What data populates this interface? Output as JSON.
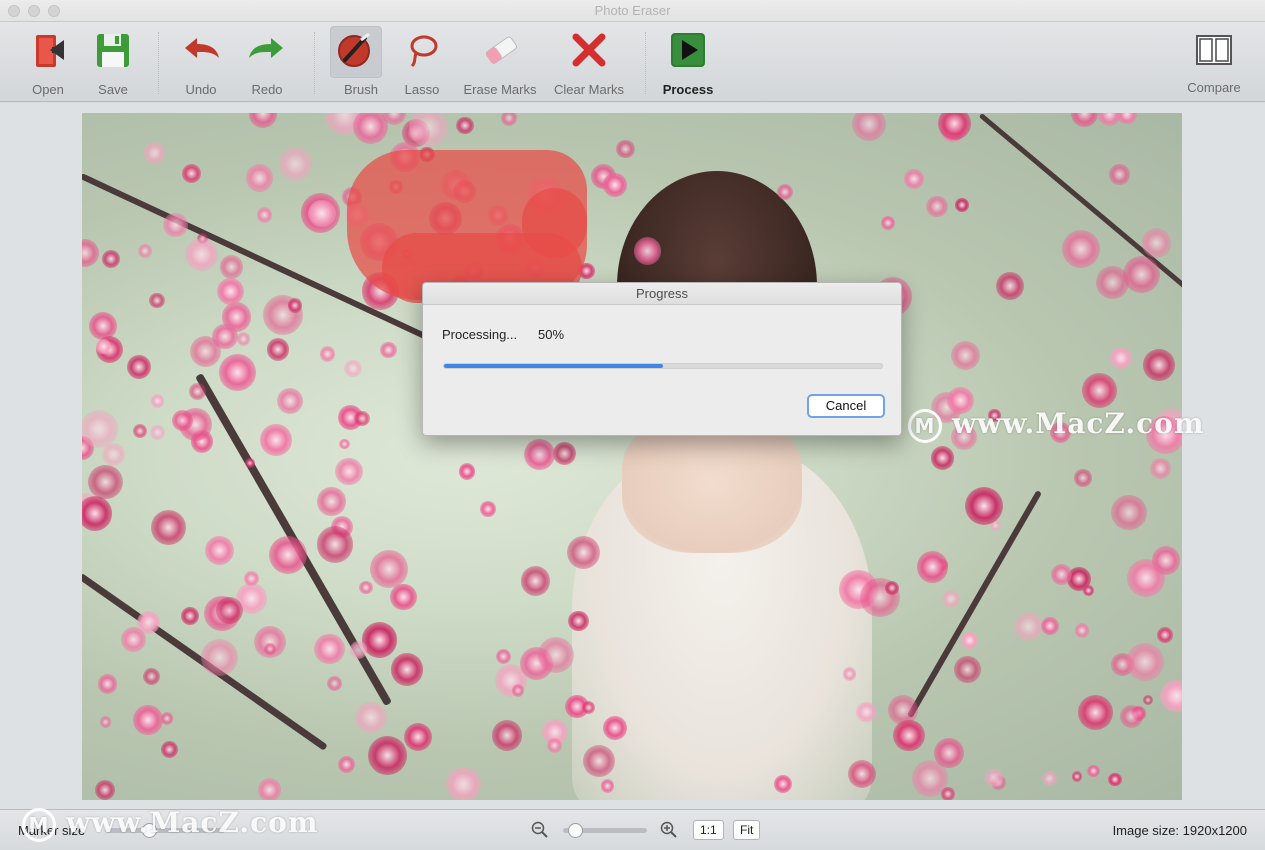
{
  "window": {
    "title": "Photo Eraser"
  },
  "toolbar": {
    "open": "Open",
    "save": "Save",
    "undo": "Undo",
    "redo": "Redo",
    "brush": "Brush",
    "lasso": "Lasso",
    "erase_marks": "Erase Marks",
    "clear_marks": "Clear Marks",
    "process": "Process",
    "compare": "Compare",
    "active_tool": "Brush"
  },
  "dialog": {
    "title": "Progress",
    "status": "Processing...",
    "percent_label": "50%",
    "progress": 0.5,
    "cancel": "Cancel"
  },
  "watermark": {
    "text": "www.MacZ.com"
  },
  "bottombar": {
    "marker_size_label": "Marker size",
    "zoom_1to1": "1:1",
    "zoom_fit": "Fit",
    "image_size": "Image size: 1920x1200"
  },
  "colors": {
    "brush_mark": "#e74b46",
    "progress_fill": "#3f86e8",
    "accent": "#6fa3ee"
  }
}
